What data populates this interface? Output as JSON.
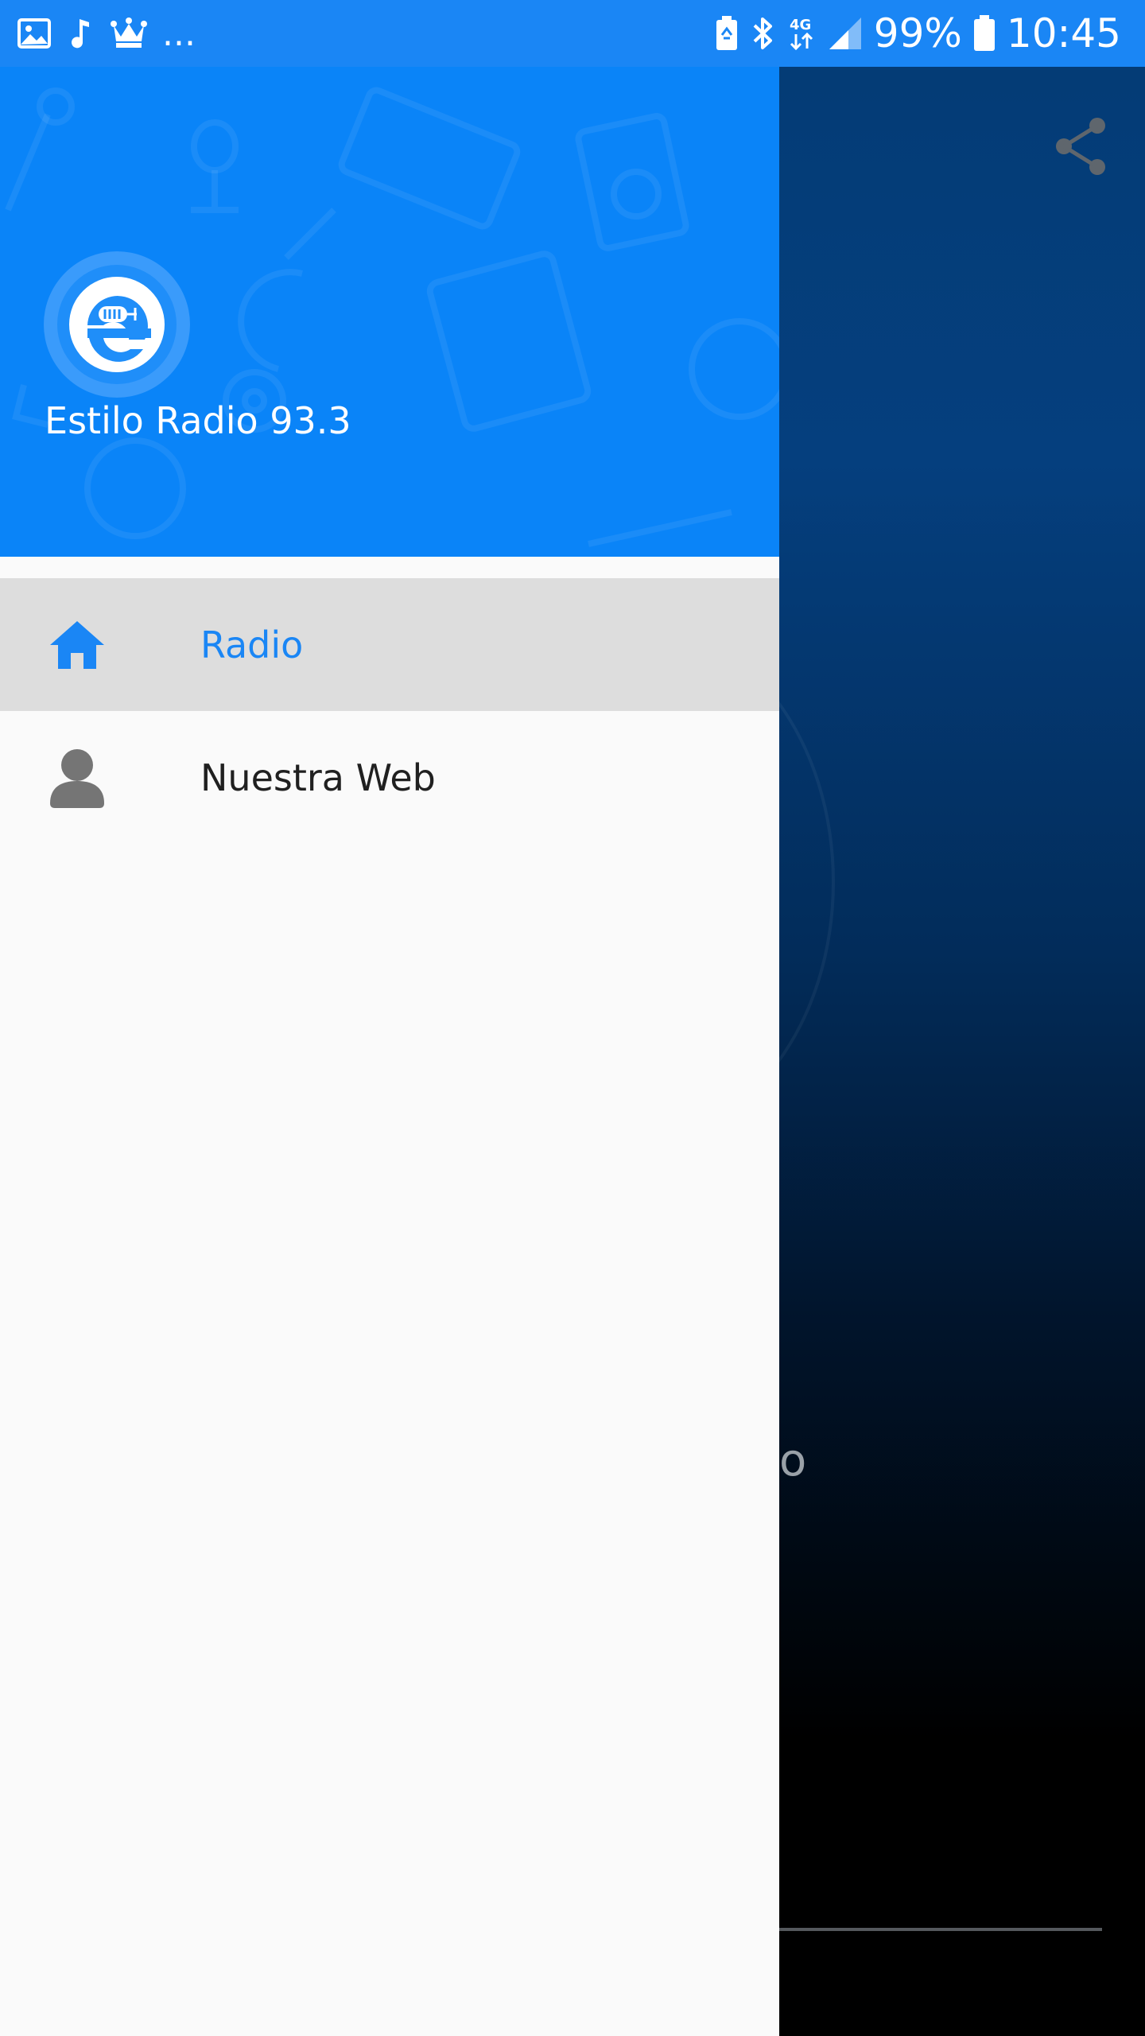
{
  "status_bar": {
    "left_icons": [
      "image-icon",
      "music-note-icon",
      "crown-icon"
    ],
    "overflow": "...",
    "right_icons": [
      "battery-saver-icon",
      "bluetooth-icon",
      "data-4g-icon",
      "signal-icon"
    ],
    "network": "4G",
    "battery": "99%",
    "time": "10:45"
  },
  "drawer": {
    "header": {
      "logo_icon": "estilo-radio-logo",
      "station_name": "Estilo Radio 93.3"
    },
    "items": [
      {
        "label": "Radio",
        "icon": "home-icon",
        "selected": true
      },
      {
        "label": "Nuestra Web",
        "icon": "person-icon",
        "selected": false
      }
    ]
  },
  "main": {
    "share_icon": "share-icon",
    "partial_text": "o"
  },
  "colors": {
    "accent": "#1a86f5",
    "header": "#0a84f8",
    "drawer_bg": "#fafafa",
    "selected_bg": "#dddddd"
  }
}
